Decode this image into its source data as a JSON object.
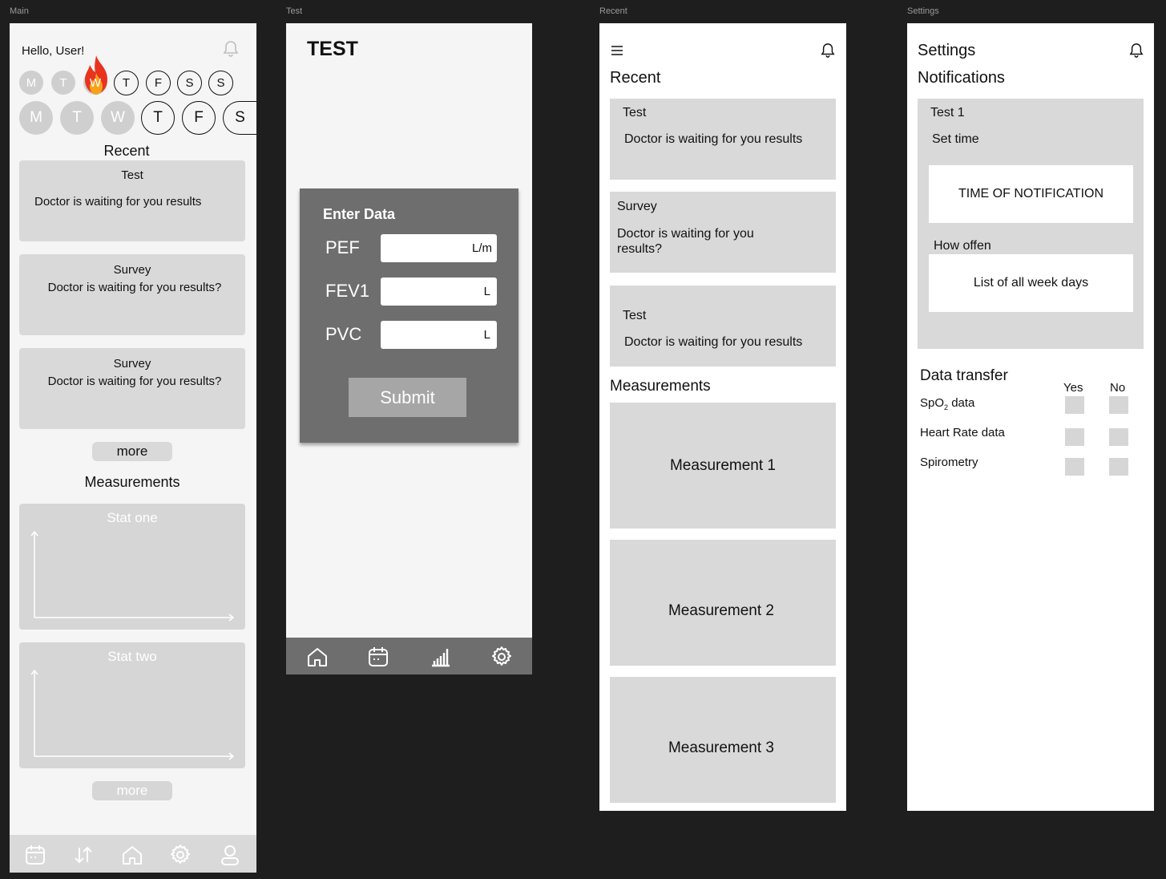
{
  "frames": {
    "main": "Main",
    "test": "Test",
    "recent": "Recent",
    "settings": "Settings"
  },
  "main": {
    "greeting": "Hello, User!",
    "week_row1": [
      "M",
      "T",
      "W",
      "T",
      "F",
      "S",
      "S"
    ],
    "week_row2": [
      "M",
      "T",
      "W",
      "T",
      "F",
      "S"
    ],
    "recent_title": "Recent",
    "cards": [
      {
        "title": "Test",
        "body": "Doctor is waiting for you results"
      },
      {
        "title": "Survey",
        "body": "Doctor is waiting for you results?"
      },
      {
        "title": "Survey",
        "body": "Doctor is waiting for you results?"
      }
    ],
    "more_label": "more",
    "measurements_title": "Measurements",
    "stats": [
      "Stat one",
      "Stat two"
    ],
    "more2_label": "more"
  },
  "test": {
    "title": "TEST",
    "form_title": "Enter Data",
    "fields": [
      {
        "label": "PEF",
        "unit": "L/m"
      },
      {
        "label": "FEV1",
        "unit": "L"
      },
      {
        "label": "PVC",
        "unit": "L"
      }
    ],
    "submit_label": "Submit"
  },
  "recent": {
    "title": "Recent",
    "cards": [
      {
        "title": "Test",
        "body": "Doctor is waiting for you results"
      },
      {
        "title": "Survey",
        "body": "Doctor is waiting for you results?"
      },
      {
        "title": "Test",
        "body": "Doctor is waiting for you results"
      }
    ],
    "measurements_title": "Measurements",
    "measurements": [
      "Measurement 1",
      "Measurement 2",
      "Measurement 3"
    ]
  },
  "settings": {
    "title": "Settings",
    "notifications_title": "Notifications",
    "test_label": "Test 1",
    "set_time_label": "Set time",
    "time_box": "TIME OF NOTIFICATION",
    "how_often_label": "How offen",
    "weekdays_box": "List of all week days",
    "data_transfer_title": "Data transfer",
    "yes_label": "Yes",
    "no_label": "No",
    "rows": [
      {
        "prefix": "SpO",
        "sub": "2",
        "suffix": " data"
      },
      {
        "prefix": "Heart Rate data",
        "sub": "",
        "suffix": ""
      },
      {
        "prefix": "Spirometry",
        "sub": "",
        "suffix": ""
      }
    ]
  },
  "icons": {
    "bell": "bell-icon",
    "hamburger": "menu-icon",
    "fire": "fire-icon",
    "calendar": "calendar-icon",
    "swap": "swap-arrows-icon",
    "home": "home-icon",
    "gear": "gear-icon",
    "user": "user-icon",
    "stats": "bar-chart-icon"
  },
  "colors": {
    "canvas": "#1e1e1e",
    "frame_light": "#f5f5f5",
    "frame_white": "#ffffff",
    "card": "#d9d9d9",
    "form_panel": "#6e6e6e",
    "submit": "#a6a6a6",
    "navbar_dark": "#6e6e6e"
  }
}
